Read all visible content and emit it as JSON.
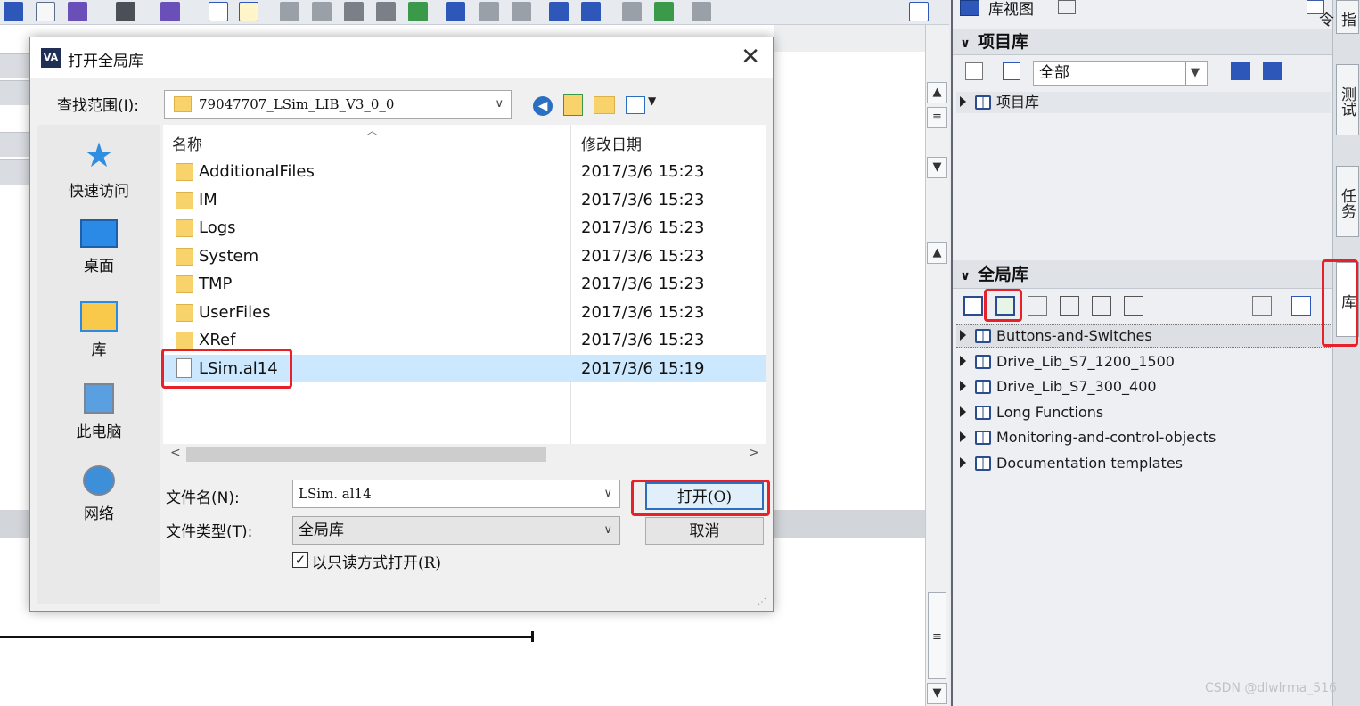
{
  "dialog": {
    "title": "打开全局库",
    "look_in_label": "查找范围(I):",
    "look_in_value": "79047707_LSim_LIB_V3_0_0",
    "places": [
      "快速访问",
      "桌面",
      "库",
      "此电脑",
      "网络"
    ],
    "col_name": "名称",
    "col_date": "修改日期",
    "files": [
      {
        "name": "AdditionalFiles",
        "date": "2017/3/6 15:23",
        "kind": "folder"
      },
      {
        "name": "IM",
        "date": "2017/3/6 15:23",
        "kind": "folder"
      },
      {
        "name": "Logs",
        "date": "2017/3/6 15:23",
        "kind": "folder"
      },
      {
        "name": "System",
        "date": "2017/3/6 15:23",
        "kind": "folder"
      },
      {
        "name": "TMP",
        "date": "2017/3/6 15:23",
        "kind": "folder"
      },
      {
        "name": "UserFiles",
        "date": "2017/3/6 15:23",
        "kind": "folder"
      },
      {
        "name": "XRef",
        "date": "2017/3/6 15:23",
        "kind": "folder"
      },
      {
        "name": "LSim.al14",
        "date": "2017/3/6 15:19",
        "kind": "file",
        "selected": true
      }
    ],
    "filename_label": "文件名(N):",
    "filename_value": "LSim. al14",
    "filetype_label": "文件类型(T):",
    "filetype_value": "全局库",
    "readonly_label": "以只读方式打开(R)",
    "readonly_checked": true,
    "open_button": "打开(O)",
    "cancel_button": "取消"
  },
  "right_panel": {
    "library_view_label": "库视图",
    "project_lib_header": "项目库",
    "filter_value": "全部",
    "project_lib_item": "项目库",
    "global_lib_header": "全局库",
    "global_libs": [
      "Buttons-and-Switches",
      "Drive_Lib_S7_1200_1500",
      "Drive_Lib_S7_300_400",
      "Long Functions",
      "Monitoring-and-control-objects",
      "Documentation templates"
    ]
  },
  "side_tabs": [
    "指令",
    "测试",
    "任务",
    "库"
  ],
  "watermark": "CSDN @dlwlrma_516",
  "colors": {
    "highlight": "#e8202a",
    "selection": "#cce8ff",
    "folder": "#f8d36b"
  }
}
